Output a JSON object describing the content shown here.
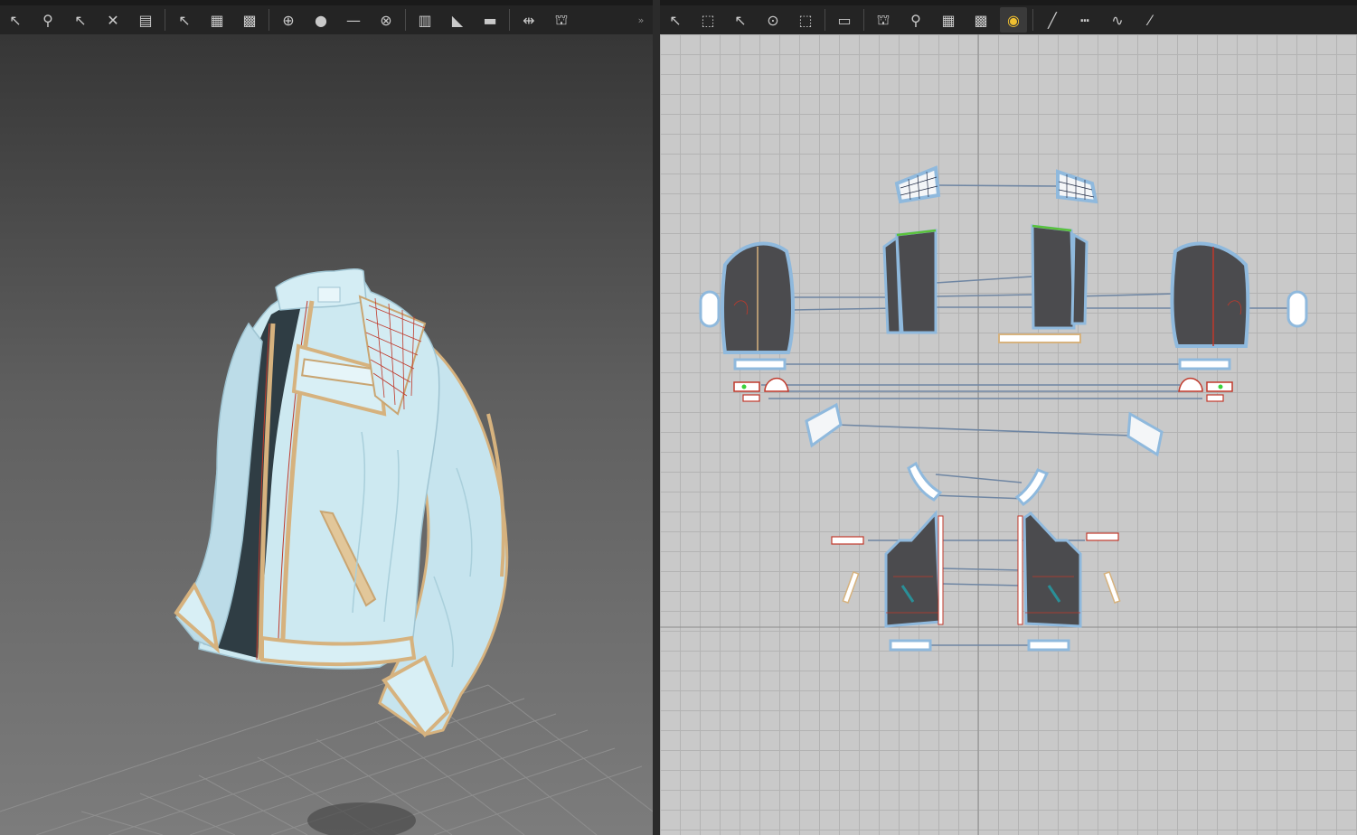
{
  "toolbar_3d": {
    "tools": [
      {
        "name": "select-mesh-tool",
        "glyph": "↖"
      },
      {
        "name": "pin-tool",
        "glyph": "⚲"
      },
      {
        "name": "transform-pattern-tool",
        "glyph": "↖"
      },
      {
        "name": "fold-tool",
        "glyph": "✕"
      },
      {
        "name": "garment-fitting-tool",
        "glyph": "▤"
      },
      {
        "name": "sew-tool",
        "glyph": "↖"
      },
      {
        "name": "topstitch-tool",
        "glyph": "▦"
      },
      {
        "name": "fabric-tool",
        "glyph": "▩"
      },
      {
        "name": "button-tool",
        "glyph": "⊕"
      },
      {
        "name": "buttonhole-tool",
        "glyph": "●"
      },
      {
        "name": "line-tool",
        "glyph": "—"
      },
      {
        "name": "zipper-tool",
        "glyph": "⊗"
      },
      {
        "name": "measure-tool",
        "glyph": "▥"
      },
      {
        "name": "puckering-tool",
        "glyph": "◣"
      },
      {
        "name": "tape-tool",
        "glyph": "▬"
      },
      {
        "name": "shrink-tool",
        "glyph": "⇹"
      },
      {
        "name": "avatar-tool",
        "glyph": "⛫"
      }
    ],
    "more_glyph": "»"
  },
  "toolbar_2d": {
    "tools": [
      {
        "name": "edit-pattern-tool",
        "glyph": "↖"
      },
      {
        "name": "transform-pattern-tool",
        "glyph": "⬚"
      },
      {
        "name": "edit-curvature-tool",
        "glyph": "↖"
      },
      {
        "name": "add-point-tool",
        "glyph": "⊙"
      },
      {
        "name": "cut-pattern-tool",
        "glyph": "⬚"
      },
      {
        "name": "iron-tool",
        "glyph": "▭"
      },
      {
        "name": "segment-sewing-tool",
        "glyph": "⛫"
      },
      {
        "name": "free-sewing-tool",
        "glyph": "⚲"
      },
      {
        "name": "topstitch-2d-tool",
        "glyph": "▦"
      },
      {
        "name": "fabric-2d-tool",
        "glyph": "▩"
      },
      {
        "name": "pin-2d-tool",
        "glyph": "◉"
      },
      {
        "name": "internal-line-tool",
        "glyph": "╱"
      },
      {
        "name": "dashed-line-tool",
        "glyph": "┅"
      },
      {
        "name": "curve-line-tool",
        "glyph": "∿"
      },
      {
        "name": "baseline-tool",
        "glyph": "⁄"
      }
    ],
    "active_tool": "pin-2d-tool"
  },
  "colors": {
    "jacket_fabric": "#cde9f1",
    "jacket_shadow": "#9fc4d2",
    "jacket_lining": "#2f3d44",
    "piping_trim": "#d6b27e",
    "seam_line": "#c0392b",
    "pattern_fill": "#4b4b4e",
    "pattern_outline": "#8fb9dd",
    "sewing_line": "#6f86a3",
    "grid_bg": "#c9c9c9",
    "grid_line": "#b3b3b3"
  }
}
